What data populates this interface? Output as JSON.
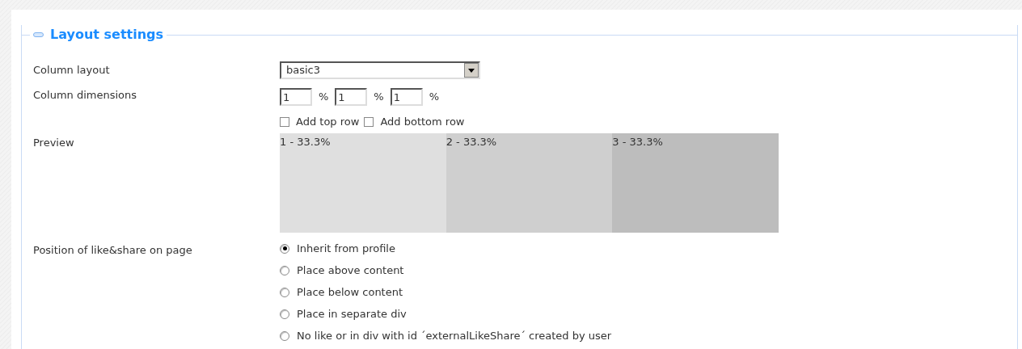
{
  "section": {
    "title": "Layout settings",
    "expanded": true
  },
  "column_layout": {
    "label": "Column layout",
    "value": "basic3"
  },
  "column_dimensions": {
    "label": "Column dimensions",
    "fields": [
      {
        "value": "1",
        "unit": "%"
      },
      {
        "value": "1",
        "unit": "%"
      },
      {
        "value": "1",
        "unit": "%"
      }
    ]
  },
  "row_options": [
    {
      "label": "Add top row",
      "checked": false
    },
    {
      "label": "Add bottom row",
      "checked": false
    }
  ],
  "preview": {
    "label": "Preview",
    "columns": [
      {
        "label": "1 - 33.3%",
        "color": "#dfdfdf"
      },
      {
        "label": "2 - 33.3%",
        "color": "#cfcfcf"
      },
      {
        "label": "3 - 33.3%",
        "color": "#bdbdbd"
      }
    ]
  },
  "like_share_position": {
    "label": "Position of like&share on page",
    "options": [
      {
        "label": "Inherit from profile",
        "selected": true
      },
      {
        "label": "Place above content",
        "selected": false
      },
      {
        "label": "Place below content",
        "selected": false
      },
      {
        "label": "Place in separate div",
        "selected": false
      },
      {
        "label": "No like or in div with id ´externalLikeShare´ created by user",
        "selected": false
      }
    ]
  }
}
